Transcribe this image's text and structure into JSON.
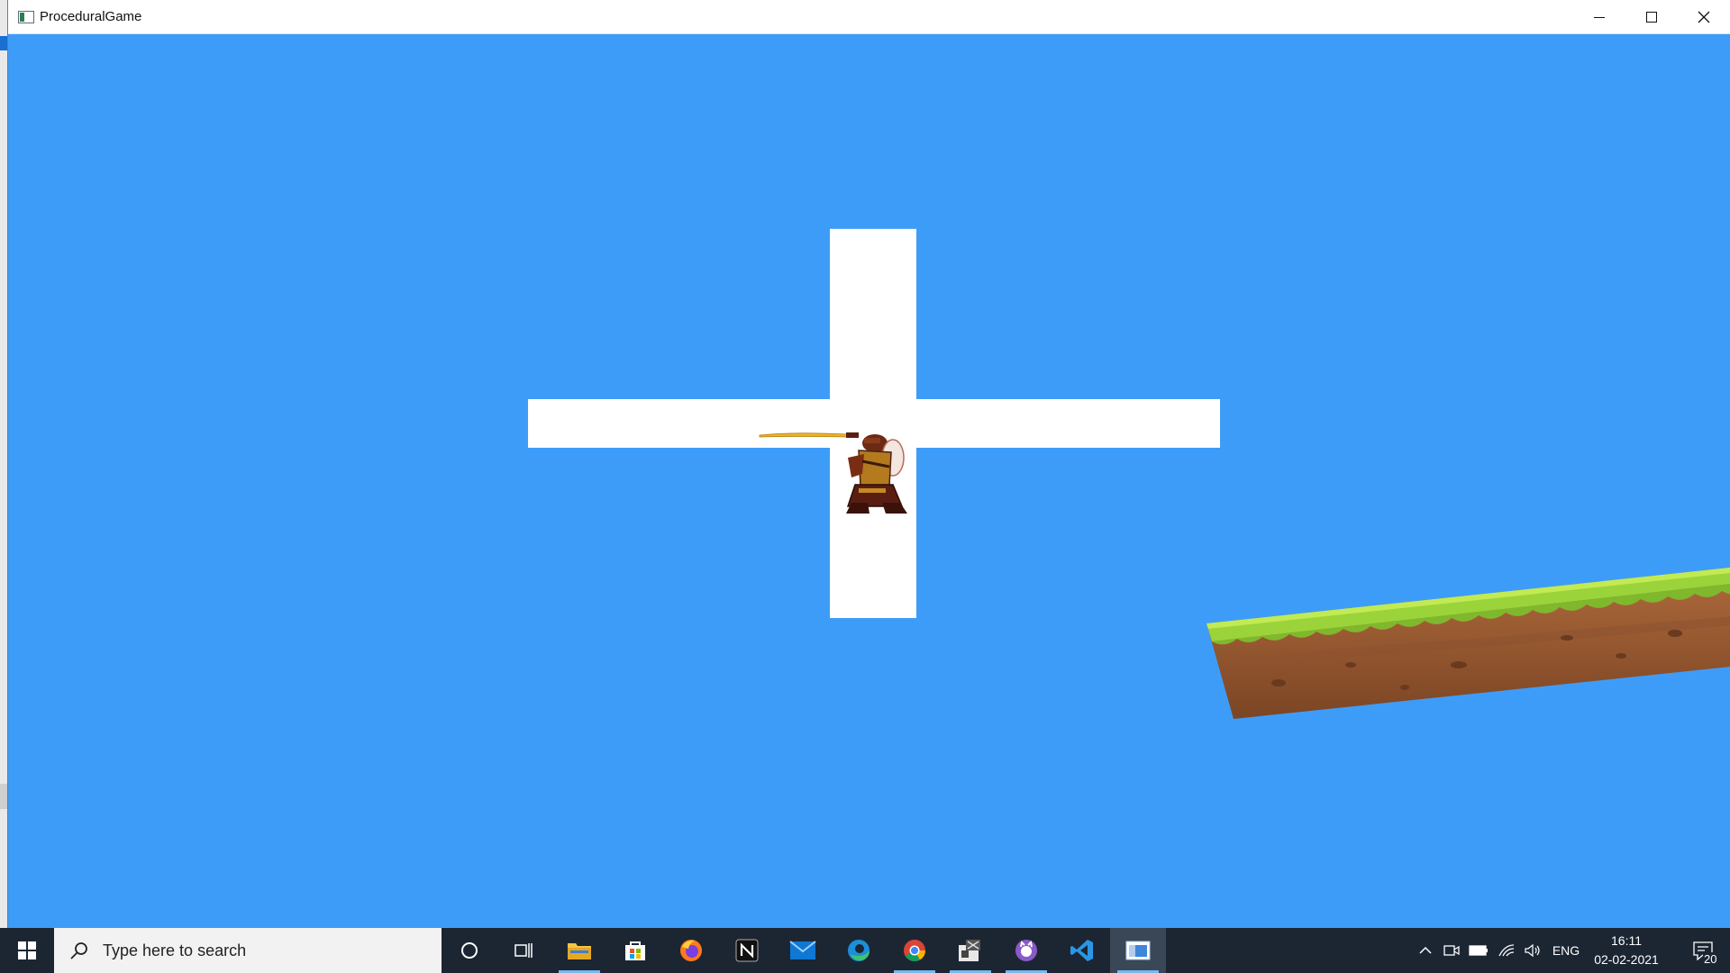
{
  "window": {
    "title": "ProceduralGame",
    "minimize_icon": "minimize-icon",
    "maximize_icon": "maximize-icon",
    "close_icon": "close-icon"
  },
  "game": {
    "sky_color": "#3e9cf9",
    "cross_color": "#ffffff",
    "player": "samurai-warrior-sprite",
    "platform": "grass-dirt-platform"
  },
  "taskbar": {
    "search_placeholder": "Type here to search",
    "pinned": [
      "cortana-icon",
      "task-view-icon",
      "file-explorer-icon",
      "microsoft-store-icon",
      "firefox-icon",
      "notion-icon",
      "mail-icon",
      "edge-icon",
      "chrome-icon",
      "game-app-icon",
      "github-desktop-icon",
      "vscode-icon",
      "procedural-game-icon"
    ],
    "language": "ENG",
    "time": "16:11",
    "date": "02-02-2021",
    "notification_count": "20"
  }
}
